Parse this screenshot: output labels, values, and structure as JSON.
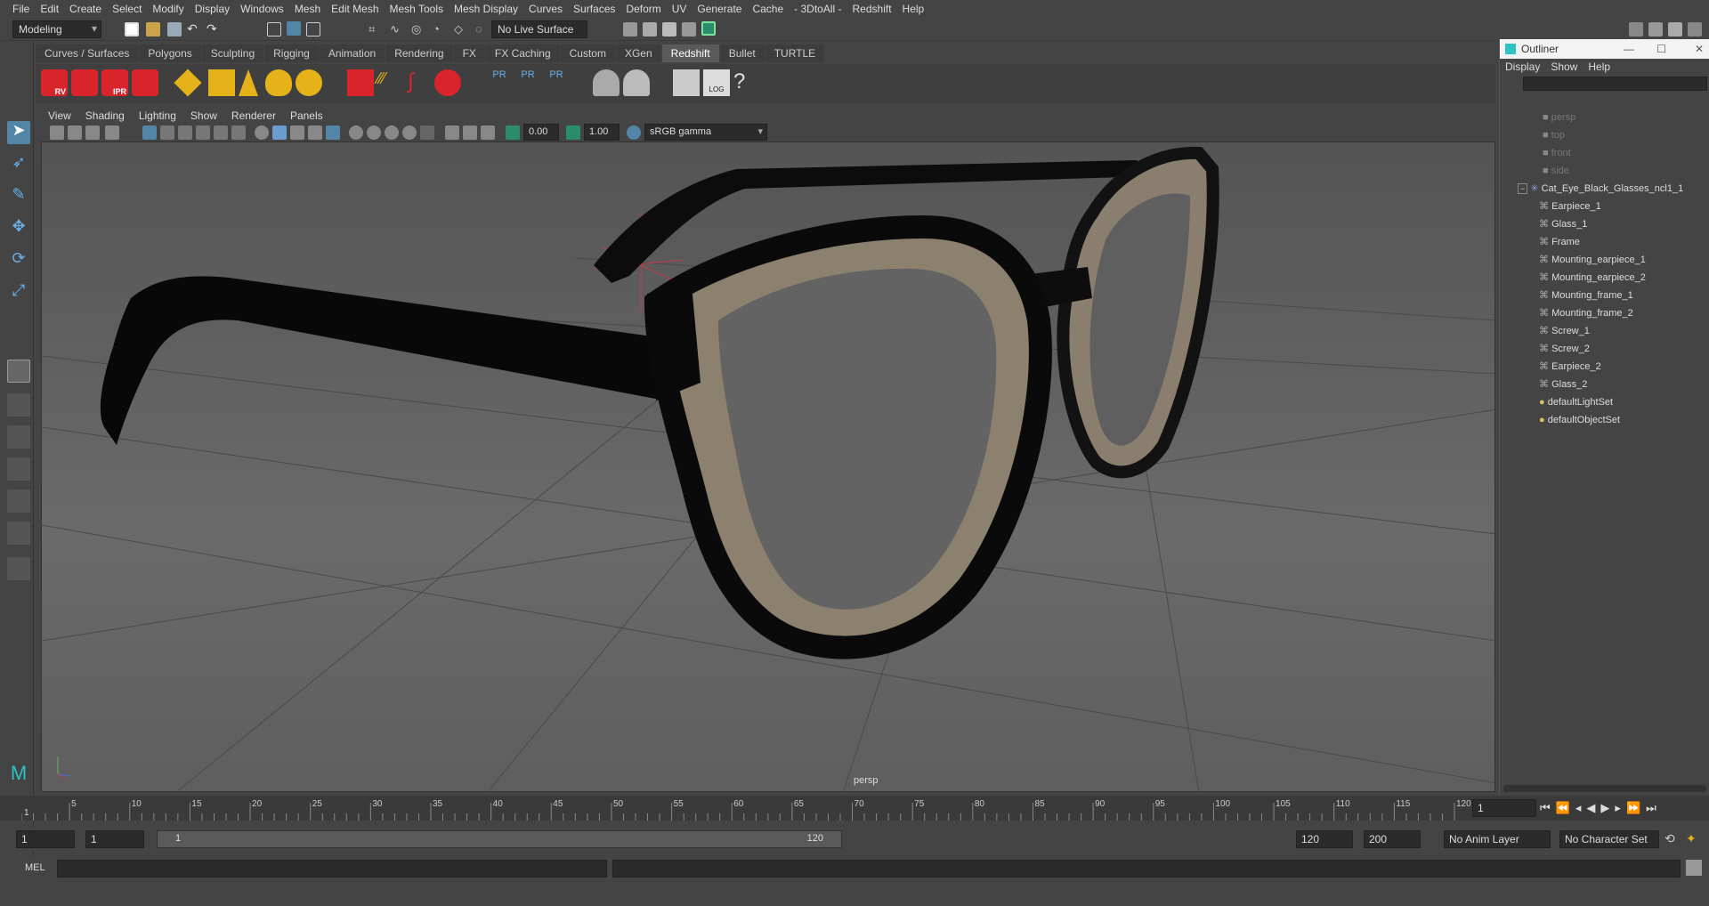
{
  "menubar": [
    "File",
    "Edit",
    "Create",
    "Select",
    "Modify",
    "Display",
    "Windows",
    "Mesh",
    "Edit Mesh",
    "Mesh Tools",
    "Mesh Display",
    "Curves",
    "Surfaces",
    "Deform",
    "UV",
    "Generate",
    "Cache",
    "- 3DtoAll -",
    "Redshift",
    "Help"
  ],
  "statusline": {
    "mode": "Modeling",
    "live_surface": "No Live Surface"
  },
  "shelf_tabs": [
    "Curves / Surfaces",
    "Polygons",
    "Sculpting",
    "Rigging",
    "Animation",
    "Rendering",
    "FX",
    "FX Caching",
    "Custom",
    "XGen",
    "Redshift",
    "Bullet",
    "TURTLE"
  ],
  "shelf_active": "Redshift",
  "shelf_labels": {
    "rv": "RV",
    "ipr": "IPR",
    "pr1": "PR",
    "pr2": "PR",
    "pr3": "PR",
    "log": "LOG"
  },
  "viewport": {
    "menu": [
      "View",
      "Shading",
      "Lighting",
      "Show",
      "Renderer",
      "Panels"
    ],
    "exposure": "0.00",
    "gamma": "1.00",
    "colorspace": "sRGB gamma",
    "camera_label": "persp"
  },
  "outliner": {
    "title": "Outliner",
    "menu": [
      "Display",
      "Show",
      "Help"
    ],
    "cameras": [
      "persp",
      "top",
      "front",
      "side"
    ],
    "group": "Cat_Eye_Black_Glasses_ncl1_1",
    "children": [
      "Earpiece_1",
      "Glass_1",
      "Frame",
      "Mounting_earpiece_1",
      "Mounting_earpiece_2",
      "Mounting_frame_1",
      "Mounting_frame_2",
      "Screw_1",
      "Screw_2",
      "Earpiece_2",
      "Glass_2"
    ],
    "sets": [
      "defaultLightSet",
      "defaultObjectSet"
    ]
  },
  "timeline": {
    "ticks": [
      "5",
      "10",
      "15",
      "20",
      "25",
      "30",
      "35",
      "40",
      "45",
      "50",
      "55",
      "60",
      "65",
      "70",
      "75",
      "80",
      "85",
      "90",
      "95",
      "100",
      "105",
      "110",
      "115",
      "120"
    ],
    "start_marker": "1",
    "current_frame": "1"
  },
  "range": {
    "start": "1",
    "playback_start": "1",
    "slider_start": "1",
    "slider_end": "120",
    "playback_end": "120",
    "end": "200",
    "anim_layer": "No Anim Layer",
    "character_set": "No Character Set"
  },
  "cmdline": {
    "lang": "MEL"
  },
  "colors": {
    "accent_tab": "#5a5a5a",
    "redshift_red": "#d9242b",
    "shelf_gold": "#e6b21a",
    "highlight_blue": "#5285a6"
  }
}
